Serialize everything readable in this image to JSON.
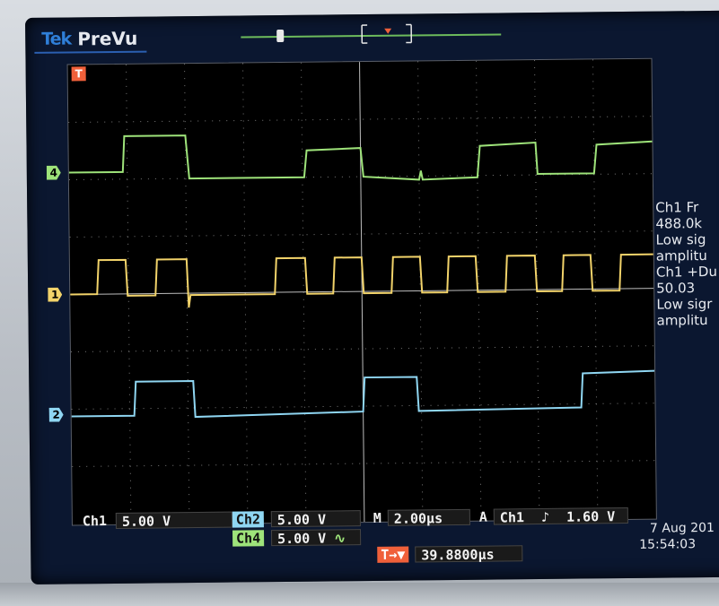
{
  "header": {
    "brand": "Tek",
    "mode": "PreVu"
  },
  "markers": {
    "trigger": "T",
    "ch4": "4",
    "ch1": "1",
    "ch2": "2"
  },
  "readouts": {
    "ch1_label": "Ch1",
    "ch1_scale": "5.00 V",
    "ch2_label": "Ch2",
    "ch2_scale": "5.00 V",
    "ch4_label": "Ch4",
    "ch4_scale": "5.00 V",
    "ch4_coupling_symbol": "∿",
    "time_label": "M",
    "time_scale": "2.00µs",
    "trigger_label": "A",
    "trigger_source": "Ch1",
    "trigger_slope_symbol": "♪",
    "trigger_level": "1.60 V",
    "position_prefix": "T→▼",
    "position_value": "39.8800µs"
  },
  "side_panel": {
    "lines": [
      "Ch1 Fr",
      "488.0k",
      "Low sig",
      "amplitu",
      "Ch1 +Du",
      "50.03 ",
      "Low sigr",
      "amplitu"
    ]
  },
  "datetime": {
    "date": "7 Aug 201",
    "time": "15:54:03"
  },
  "colors": {
    "ch4": "#9ee37a",
    "ch1": "#f2d36a",
    "ch2": "#8fd6f2",
    "grid": "#d8d8d8"
  }
}
